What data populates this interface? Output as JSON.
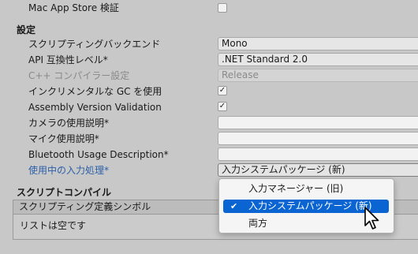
{
  "mac_app_store": {
    "label": "Mac App Store 検証",
    "checked": false
  },
  "settings_section": {
    "title": "設定"
  },
  "scripting_backend": {
    "label": "スクリプティングバックエンド",
    "value": "Mono"
  },
  "api_compat": {
    "label": "API 互換性レベル*",
    "value": ".NET Standard 2.0"
  },
  "cpp_compiler": {
    "label": "C++ コンパイラー設定",
    "value": "Release"
  },
  "incremental_gc": {
    "label": "インクリメンタルな GC を使用",
    "checked": true,
    "check_mark": "✓"
  },
  "assembly_validation": {
    "label": "Assembly Version Validation",
    "checked": true,
    "check_mark": "✓"
  },
  "camera_usage": {
    "label": "カメラの使用説明*",
    "value": ""
  },
  "mic_usage": {
    "label": "マイク使用説明*",
    "value": ""
  },
  "bluetooth_usage": {
    "label": "Bluetooth Usage Description*",
    "value": ""
  },
  "active_input": {
    "label": "使用中の入力処理*",
    "value": "入力システムパッケージ (新)"
  },
  "script_compile_section": {
    "title": "スクリプトコンパイル"
  },
  "scripting_define_symbols": {
    "header": "スクリプティング定義シンボル",
    "empty_text": "リストは空です"
  },
  "input_dropdown": {
    "options": [
      {
        "label": "入力マネージャー (旧)",
        "selected": false
      },
      {
        "label": "入力システムパッケージ (新)",
        "selected": true
      },
      {
        "label": "両方",
        "selected": false
      }
    ],
    "check_mark": "✔",
    "selected_color": "#0a64d2"
  },
  "icons": {
    "cursor": "arrow-cursor-icon",
    "check": "checkmark-icon"
  }
}
